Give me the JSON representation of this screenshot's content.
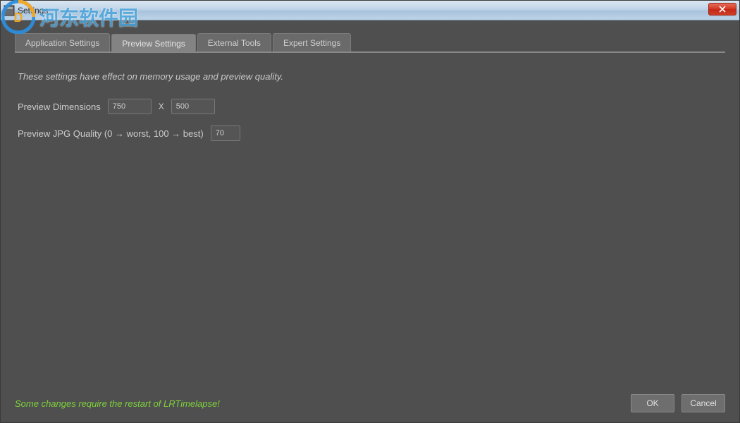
{
  "window": {
    "title": "Settings"
  },
  "watermark": {
    "text": "河东软件园"
  },
  "tabs": [
    {
      "label": "Application Settings"
    },
    {
      "label": "Preview Settings"
    },
    {
      "label": "External Tools"
    },
    {
      "label": "Expert Settings"
    }
  ],
  "panel": {
    "description": "These settings have effect on memory usage and preview quality.",
    "dimensions_label": "Preview Dimensions",
    "dimensions_width": "750",
    "dimensions_sep": "X",
    "dimensions_height": "500",
    "quality_label": "Preview JPG Quality (0 → worst, 100 → best)",
    "quality_value": "70"
  },
  "footer": {
    "restart_note": "Some changes require the restart of LRTimelapse!",
    "ok": "OK",
    "cancel": "Cancel"
  }
}
